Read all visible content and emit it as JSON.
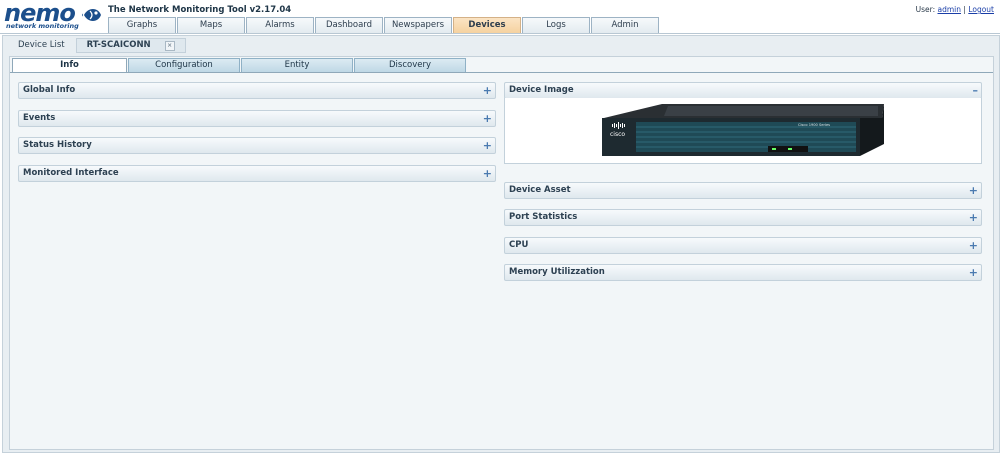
{
  "app": {
    "logo_text": "nemo",
    "logo_tagline": "network monitoring",
    "title": "The Network Monitoring Tool v2.17.04"
  },
  "user": {
    "label": "User:",
    "name": "admin",
    "separator": "|",
    "logout": "Logout"
  },
  "nav": {
    "tabs": [
      "Graphs",
      "Maps",
      "Alarms",
      "Dashboard",
      "Newspapers",
      "Devices",
      "Logs",
      "Admin"
    ],
    "active": "Devices"
  },
  "subtabs": {
    "device_list": "Device List",
    "device": "RT-SCAICONN",
    "close_glyph": "×"
  },
  "device_tabs": {
    "items": [
      "Info",
      "Configuration",
      "Entity",
      "Discovery"
    ],
    "active": "Info"
  },
  "left_sections": [
    {
      "title": "Global Info",
      "toggle": "+"
    },
    {
      "title": "Events",
      "toggle": "+"
    },
    {
      "title": "Status History",
      "toggle": "+"
    },
    {
      "title": "Monitored Interface",
      "toggle": "+"
    }
  ],
  "right_sections": [
    {
      "title": "Device Image",
      "toggle": "–"
    },
    {
      "title": "Device Asset",
      "toggle": "+"
    },
    {
      "title": "Port Statistics",
      "toggle": "+"
    },
    {
      "title": "CPU",
      "toggle": "+"
    },
    {
      "title": "Memory Utilizzation",
      "toggle": "+"
    }
  ],
  "device_image": {
    "brand": "cisco",
    "model": "Cisco 1900 Series"
  },
  "colors": {
    "active_tab": "#f5d2a0",
    "accordion_header": "#dfe8ee",
    "panel_bg": "#f2f6f8",
    "logo_blue": "#1c4f8c",
    "toggle_blue": "#4a7ab0"
  }
}
